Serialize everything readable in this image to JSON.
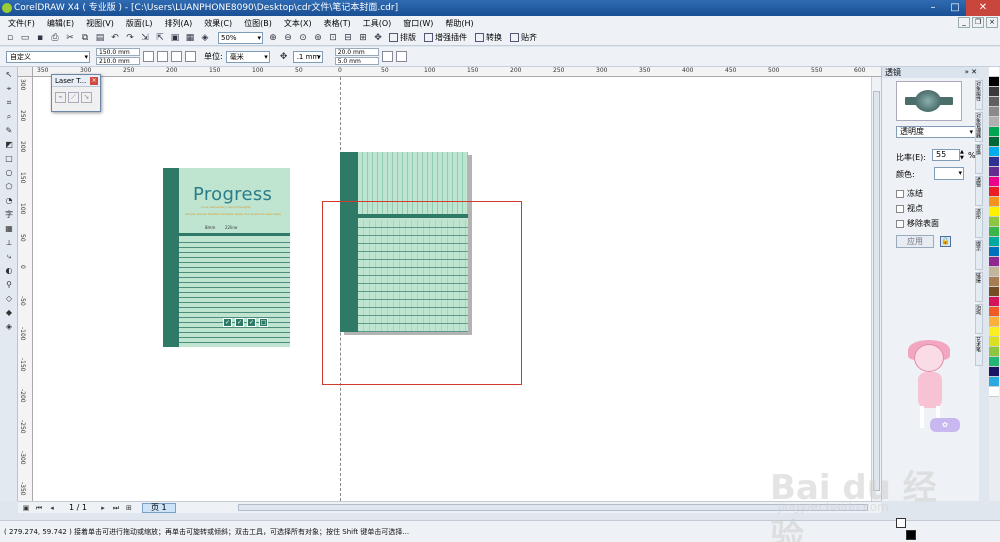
{
  "window": {
    "title": "CorelDRAW X4 ( 专业版 ) - [C:\\Users\\LUANPHONE8090\\Desktop\\cdr文件\\笔记本封面.cdr]"
  },
  "menu": [
    "文件(F)",
    "编辑(E)",
    "视图(V)",
    "版面(L)",
    "排列(A)",
    "效果(C)",
    "位图(B)",
    "文本(X)",
    "表格(T)",
    "工具(O)",
    "窗口(W)",
    "帮助(H)"
  ],
  "toolbar": {
    "zoom": "50%",
    "buttons": [
      "排版",
      "增强插件",
      "转换",
      "贴齐"
    ]
  },
  "property_bar": {
    "paper": "自定义",
    "width": "150.0 mm",
    "height": "210.0 mm",
    "unit_label": "单位:",
    "unit_value": "毫米",
    "nudge": ".1 mm",
    "dup_x": "20.0 mm",
    "dup_y": "5.0 mm"
  },
  "ruler": {
    "h_ticks": [
      "350",
      "300",
      "250",
      "200",
      "150",
      "100",
      "50",
      "0",
      "50",
      "100",
      "150",
      "200",
      "250",
      "300",
      "350",
      "400",
      "450",
      "500",
      "550",
      "600"
    ],
    "v_ticks": [
      "300",
      "250",
      "200",
      "150",
      "100",
      "50",
      "0",
      "-50",
      "-100",
      "-150",
      "-200",
      "-250",
      "-300",
      "-350"
    ]
  },
  "laser_panel": {
    "title": "Laser T..."
  },
  "notebook_front": {
    "title": "Progress",
    "subtitle1": "Love elementary report thoughts",
    "subtitle2": "sample proven flexible formable rarely and practical reasonably",
    "spec1": "8mm",
    "spec2": "22line"
  },
  "page_nav": {
    "count": "1 / 1",
    "tab": "页 1"
  },
  "status": {
    "text": "( 279.274, 59.742 ) 接着单击可进行拖动或缩放；再单击可旋转或倾斜；双击工具，可选择所有对象；按住 Shift 键单击可选择..."
  },
  "docker": {
    "title": "透镜",
    "lens_type": "透明度",
    "rate_label": "比率(E):",
    "rate_value": "55",
    "rate_unit": "%",
    "color_label": "颜色:",
    "check_freeze": "冻结",
    "check_view": "视点",
    "check_remove": "移除表面",
    "apply": "应用"
  },
  "side_tabs": [
    "对象属性",
    "对象管理器",
    "变换",
    "透镜",
    "造形",
    "提示",
    "链接",
    "泊坞",
    "艺术笔"
  ],
  "palette_colors": [
    "#ffffff",
    "#000000",
    "#3a3a3a",
    "#606060",
    "#8a8a8a",
    "#b0b0b0",
    "#00a651",
    "#006837",
    "#00aeef",
    "#2e3192",
    "#662d91",
    "#ec008c",
    "#ed1c24",
    "#f7941d",
    "#fff200",
    "#8dc63f",
    "#39b54a",
    "#00a99d",
    "#0072bc",
    "#92278f",
    "#c2b59b",
    "#a67c52",
    "#754c24",
    "#d4145a",
    "#f15a24",
    "#fbb03b",
    "#fcee21",
    "#d9e021",
    "#8cc63f",
    "#22b573",
    "#1b1464",
    "#29abe2",
    "#ffffff"
  ],
  "watermark": {
    "brand": "Bai du 经验",
    "url": "jingyan.baidu.com"
  }
}
